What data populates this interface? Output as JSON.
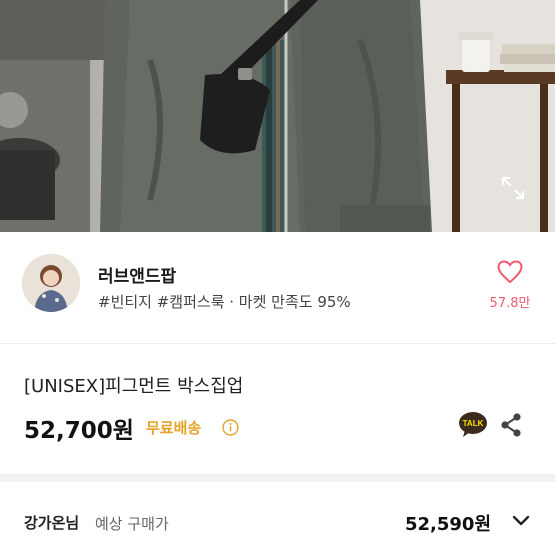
{
  "shop": {
    "name": "러브앤드팝",
    "tags": "#빈티지 #캠퍼스룩 · 마켓 만족도 95%",
    "likes": "57.8만"
  },
  "product": {
    "title": "[UNISEX]피그먼트 박스집업",
    "price": "52,700원",
    "shipping": "무료배송"
  },
  "actions": {
    "talk_label": "TALK"
  },
  "buyer": {
    "name": "강가온님",
    "label": "예상 구매가",
    "price": "52,590원"
  },
  "colors": {
    "accent_pink": "#ef5c6e",
    "shipping_yellow": "#e3a42a",
    "talk_yellow": "#fae100"
  },
  "icons": [
    "expand-icon",
    "heart-icon",
    "info-icon",
    "talk-icon",
    "share-icon",
    "chevron-down-icon"
  ]
}
